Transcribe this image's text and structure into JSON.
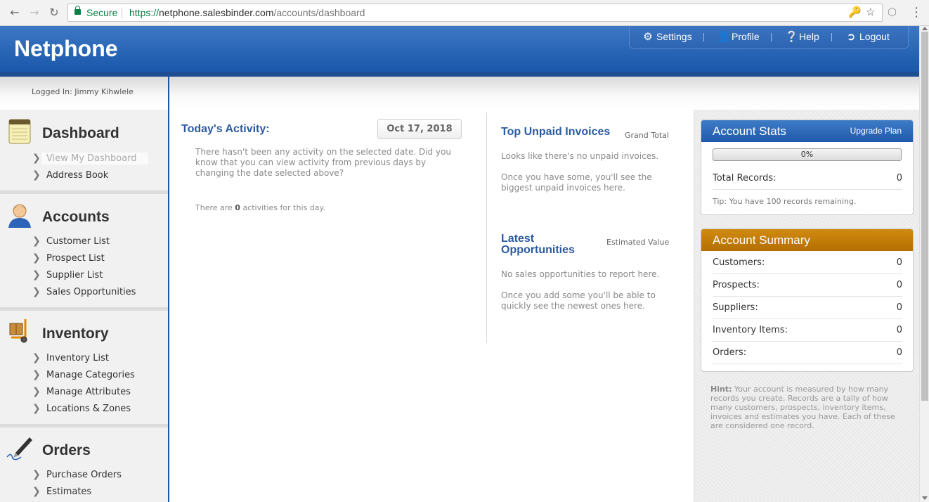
{
  "browser": {
    "secure_label": "Secure",
    "url_scheme": "https://",
    "url_host": "netphone.salesbinder.com",
    "url_path": "/accounts/dashboard"
  },
  "header": {
    "brand": "Netphone",
    "nav": {
      "settings": "Settings",
      "profile": "Profile",
      "help": "Help",
      "logout": "Logout"
    }
  },
  "user": {
    "logged_in": "Logged In: Jimmy Kihwlele"
  },
  "sidebar": {
    "dashboard": {
      "title": "Dashboard",
      "items": [
        "View My Dashboard",
        "Address Book"
      ]
    },
    "accounts": {
      "title": "Accounts",
      "items": [
        "Customer List",
        "Prospect List",
        "Supplier List",
        "Sales Opportunities"
      ]
    },
    "inventory": {
      "title": "Inventory",
      "items": [
        "Inventory List",
        "Manage Categories",
        "Manage Attributes",
        "Locations & Zones"
      ]
    },
    "orders": {
      "title": "Orders",
      "items": [
        "Purchase Orders",
        "Estimates"
      ]
    }
  },
  "activity": {
    "title": "Today's Activity:",
    "date": "Oct 17, 2018",
    "message": "There hasn't been any activity on the selected date. Did you know that you can view activity from previous days by changing the date selected above?",
    "count_prefix": "There are",
    "count": "0",
    "count_suffix": "activities for this day."
  },
  "invoices": {
    "title": "Top Unpaid Invoices",
    "column": "Grand Total",
    "line1": "Looks like there's no unpaid invoices.",
    "line2": "Once you have some, you'll see the biggest unpaid invoices here."
  },
  "opportunities": {
    "title": "Latest Opportunities",
    "column": "Estimated Value",
    "line1": "No sales opportunities to report here.",
    "line2": "Once you add some you'll be able to quickly see the newest ones here."
  },
  "account_stats": {
    "title": "Account Stats",
    "upgrade": "Upgrade Plan",
    "progress_label": "0%",
    "progress_value": 0,
    "total_label": "Total Records:",
    "total_value": "0",
    "tip": "Tip: You have 100 records remaining."
  },
  "account_summary": {
    "title": "Account Summary",
    "rows": [
      {
        "label": "Customers:",
        "value": "0"
      },
      {
        "label": "Prospects:",
        "value": "0"
      },
      {
        "label": "Suppliers:",
        "value": "0"
      },
      {
        "label": "Inventory Items:",
        "value": "0"
      },
      {
        "label": "Orders:",
        "value": "0"
      }
    ]
  },
  "hint": {
    "label": "Hint:",
    "text": "Your account is measured by how many records you create. Records are a tally of how many customers, prospects, inventory items, invoices and estimates you have. Each of these are considered one record."
  },
  "colors": {
    "brand_blue": "#1f59ab",
    "summary_orange": "#c07a05",
    "link_blue": "#2c5aa0"
  }
}
